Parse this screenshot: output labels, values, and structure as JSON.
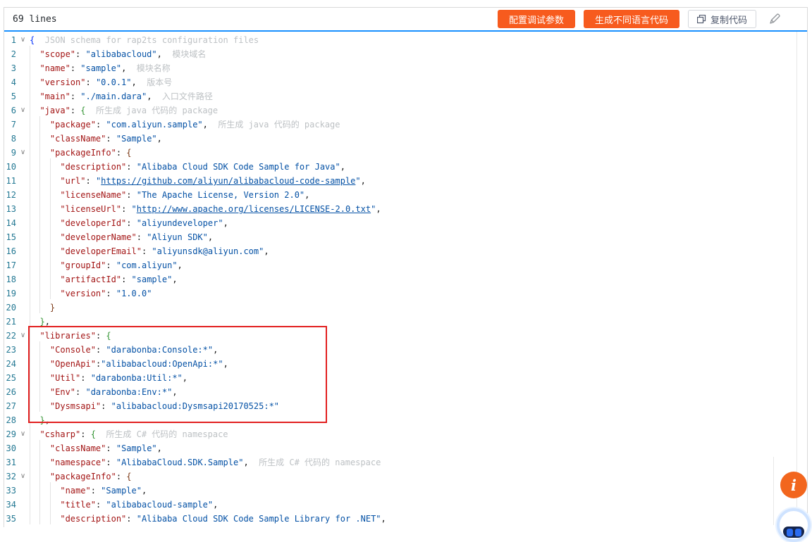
{
  "header": {
    "title": "69 lines",
    "buttons": [
      {
        "label": "配置调试参数"
      },
      {
        "label": "生成不同语言代码"
      }
    ],
    "copy_button": {
      "label": "复制代码",
      "icon": "copy-icon"
    },
    "edit_icon": "pencil-icon"
  },
  "colors": {
    "accent_orange": "#f75b1e",
    "header_rule_blue": "#1890ff",
    "highlight_box_red": "#e21f1f",
    "line_number_teal": "#237893",
    "json_key_red": "#a31515",
    "json_value_blue": "#0451a5",
    "hint_gray": "#bdc1c4"
  },
  "annotations": {
    "highlight_box_lines": [
      22,
      28
    ]
  },
  "widgets": {
    "info_label": "i",
    "robot_icon": "robot-assistant-icon"
  },
  "editor": {
    "fold_glyph": "∨",
    "lines": [
      {
        "n": 1,
        "fold": true,
        "tokens": [
          [
            "b1",
            "{"
          ],
          [
            "c",
            "  JSON schema for rap2ts configuration files"
          ]
        ]
      },
      {
        "n": 2,
        "fold": false,
        "tokens": [
          [
            "p",
            "  "
          ],
          [
            "k",
            "\"scope\""
          ],
          [
            "p",
            ": "
          ],
          [
            "s",
            "\"alibabacloud\""
          ],
          [
            "p",
            ","
          ],
          [
            "c",
            "  模块域名"
          ]
        ]
      },
      {
        "n": 3,
        "fold": false,
        "tokens": [
          [
            "p",
            "  "
          ],
          [
            "k",
            "\"name\""
          ],
          [
            "p",
            ": "
          ],
          [
            "s",
            "\"sample\""
          ],
          [
            "p",
            ","
          ],
          [
            "c",
            "  模块名称"
          ]
        ]
      },
      {
        "n": 4,
        "fold": false,
        "tokens": [
          [
            "p",
            "  "
          ],
          [
            "k",
            "\"version\""
          ],
          [
            "p",
            ": "
          ],
          [
            "s",
            "\"0.0.1\""
          ],
          [
            "p",
            ","
          ],
          [
            "c",
            "  版本号"
          ]
        ]
      },
      {
        "n": 5,
        "fold": false,
        "tokens": [
          [
            "p",
            "  "
          ],
          [
            "k",
            "\"main\""
          ],
          [
            "p",
            ": "
          ],
          [
            "s",
            "\"./main.dara\""
          ],
          [
            "p",
            ","
          ],
          [
            "c",
            "  入口文件路径"
          ]
        ]
      },
      {
        "n": 6,
        "fold": true,
        "tokens": [
          [
            "p",
            "  "
          ],
          [
            "k",
            "\"java\""
          ],
          [
            "p",
            ": "
          ],
          [
            "b2",
            "{"
          ],
          [
            "c",
            "  所生成 java 代码的 package"
          ]
        ]
      },
      {
        "n": 7,
        "fold": false,
        "tokens": [
          [
            "p",
            "    "
          ],
          [
            "k",
            "\"package\""
          ],
          [
            "p",
            ": "
          ],
          [
            "s",
            "\"com.aliyun.sample\""
          ],
          [
            "p",
            ","
          ],
          [
            "c",
            "  所生成 java 代码的 package"
          ]
        ]
      },
      {
        "n": 8,
        "fold": false,
        "tokens": [
          [
            "p",
            "    "
          ],
          [
            "k",
            "\"className\""
          ],
          [
            "p",
            ": "
          ],
          [
            "s",
            "\"Sample\""
          ],
          [
            "p",
            ","
          ]
        ]
      },
      {
        "n": 9,
        "fold": true,
        "tokens": [
          [
            "p",
            "    "
          ],
          [
            "k",
            "\"packageInfo\""
          ],
          [
            "p",
            ": "
          ],
          [
            "b3",
            "{"
          ]
        ]
      },
      {
        "n": 10,
        "fold": false,
        "tokens": [
          [
            "p",
            "      "
          ],
          [
            "k",
            "\"description\""
          ],
          [
            "p",
            ": "
          ],
          [
            "s",
            "\"Alibaba Cloud SDK Code Sample for Java\""
          ],
          [
            "p",
            ","
          ]
        ]
      },
      {
        "n": 11,
        "fold": false,
        "tokens": [
          [
            "p",
            "      "
          ],
          [
            "k",
            "\"url\""
          ],
          [
            "p",
            ": "
          ],
          [
            "s",
            "\""
          ],
          [
            "u",
            "https://github.com/aliyun/alibabacloud-code-sample"
          ],
          [
            "s",
            "\""
          ],
          [
            "p",
            ","
          ]
        ]
      },
      {
        "n": 12,
        "fold": false,
        "tokens": [
          [
            "p",
            "      "
          ],
          [
            "k",
            "\"licenseName\""
          ],
          [
            "p",
            ": "
          ],
          [
            "s",
            "\"The Apache License, Version 2.0\""
          ],
          [
            "p",
            ","
          ]
        ]
      },
      {
        "n": 13,
        "fold": false,
        "tokens": [
          [
            "p",
            "      "
          ],
          [
            "k",
            "\"licenseUrl\""
          ],
          [
            "p",
            ": "
          ],
          [
            "s",
            "\""
          ],
          [
            "u",
            "http://www.apache.org/licenses/LICENSE-2.0.txt"
          ],
          [
            "s",
            "\""
          ],
          [
            "p",
            ","
          ]
        ]
      },
      {
        "n": 14,
        "fold": false,
        "tokens": [
          [
            "p",
            "      "
          ],
          [
            "k",
            "\"developerId\""
          ],
          [
            "p",
            ": "
          ],
          [
            "s",
            "\"aliyundeveloper\""
          ],
          [
            "p",
            ","
          ]
        ]
      },
      {
        "n": 15,
        "fold": false,
        "tokens": [
          [
            "p",
            "      "
          ],
          [
            "k",
            "\"developerName\""
          ],
          [
            "p",
            ": "
          ],
          [
            "s",
            "\"Aliyun SDK\""
          ],
          [
            "p",
            ","
          ]
        ]
      },
      {
        "n": 16,
        "fold": false,
        "tokens": [
          [
            "p",
            "      "
          ],
          [
            "k",
            "\"developerEmail\""
          ],
          [
            "p",
            ": "
          ],
          [
            "s",
            "\"aliyunsdk@aliyun.com\""
          ],
          [
            "p",
            ","
          ]
        ]
      },
      {
        "n": 17,
        "fold": false,
        "tokens": [
          [
            "p",
            "      "
          ],
          [
            "k",
            "\"groupId\""
          ],
          [
            "p",
            ": "
          ],
          [
            "s",
            "\"com.aliyun\""
          ],
          [
            "p",
            ","
          ]
        ]
      },
      {
        "n": 18,
        "fold": false,
        "tokens": [
          [
            "p",
            "      "
          ],
          [
            "k",
            "\"artifactId\""
          ],
          [
            "p",
            ": "
          ],
          [
            "s",
            "\"sample\""
          ],
          [
            "p",
            ","
          ]
        ]
      },
      {
        "n": 19,
        "fold": false,
        "tokens": [
          [
            "p",
            "      "
          ],
          [
            "k",
            "\"version\""
          ],
          [
            "p",
            ": "
          ],
          [
            "s",
            "\"1.0.0\""
          ]
        ]
      },
      {
        "n": 20,
        "fold": false,
        "tokens": [
          [
            "p",
            "    "
          ],
          [
            "b3",
            "}"
          ]
        ]
      },
      {
        "n": 21,
        "fold": false,
        "tokens": [
          [
            "p",
            "  "
          ],
          [
            "b2",
            "}"
          ],
          [
            "p",
            ","
          ]
        ]
      },
      {
        "n": 22,
        "fold": true,
        "tokens": [
          [
            "p",
            "  "
          ],
          [
            "k",
            "\"libraries\""
          ],
          [
            "p",
            ": "
          ],
          [
            "b2",
            "{"
          ]
        ]
      },
      {
        "n": 23,
        "fold": false,
        "tokens": [
          [
            "p",
            "    "
          ],
          [
            "k",
            "\"Console\""
          ],
          [
            "p",
            ": "
          ],
          [
            "s",
            "\"darabonba:Console:*\""
          ],
          [
            "p",
            ","
          ]
        ]
      },
      {
        "n": 24,
        "fold": false,
        "tokens": [
          [
            "p",
            "    "
          ],
          [
            "k",
            "\"OpenApi\""
          ],
          [
            "p",
            ":"
          ],
          [
            "s",
            "\"alibabacloud:OpenApi:*\""
          ],
          [
            "p",
            ","
          ]
        ]
      },
      {
        "n": 25,
        "fold": false,
        "tokens": [
          [
            "p",
            "    "
          ],
          [
            "k",
            "\"Util\""
          ],
          [
            "p",
            ": "
          ],
          [
            "s",
            "\"darabonba:Util:*\""
          ],
          [
            "p",
            ","
          ]
        ]
      },
      {
        "n": 26,
        "fold": false,
        "tokens": [
          [
            "p",
            "    "
          ],
          [
            "k",
            "\"Env\""
          ],
          [
            "p",
            ": "
          ],
          [
            "s",
            "\"darabonba:Env:*\""
          ],
          [
            "p",
            ","
          ]
        ]
      },
      {
        "n": 27,
        "fold": false,
        "tokens": [
          [
            "p",
            "    "
          ],
          [
            "k",
            "\"Dysmsapi\""
          ],
          [
            "p",
            ": "
          ],
          [
            "s",
            "\"alibabacloud:Dysmsapi20170525:*\""
          ]
        ]
      },
      {
        "n": 28,
        "fold": false,
        "tokens": [
          [
            "p",
            "  "
          ],
          [
            "b2",
            "}"
          ],
          [
            "p",
            ","
          ]
        ]
      },
      {
        "n": 29,
        "fold": true,
        "tokens": [
          [
            "p",
            "  "
          ],
          [
            "k",
            "\"csharp\""
          ],
          [
            "p",
            ": "
          ],
          [
            "b2",
            "{"
          ],
          [
            "c",
            "  所生成 C# 代码的 namespace"
          ]
        ]
      },
      {
        "n": 30,
        "fold": false,
        "tokens": [
          [
            "p",
            "    "
          ],
          [
            "k",
            "\"className\""
          ],
          [
            "p",
            ": "
          ],
          [
            "s",
            "\"Sample\""
          ],
          [
            "p",
            ","
          ]
        ]
      },
      {
        "n": 31,
        "fold": false,
        "tokens": [
          [
            "p",
            "    "
          ],
          [
            "k",
            "\"namespace\""
          ],
          [
            "p",
            ": "
          ],
          [
            "s",
            "\"AlibabaCloud.SDK.Sample\""
          ],
          [
            "p",
            ","
          ],
          [
            "c",
            "  所生成 C# 代码的 namespace"
          ]
        ]
      },
      {
        "n": 32,
        "fold": true,
        "tokens": [
          [
            "p",
            "    "
          ],
          [
            "k",
            "\"packageInfo\""
          ],
          [
            "p",
            ": "
          ],
          [
            "b3",
            "{"
          ]
        ]
      },
      {
        "n": 33,
        "fold": false,
        "tokens": [
          [
            "p",
            "      "
          ],
          [
            "k",
            "\"name\""
          ],
          [
            "p",
            ": "
          ],
          [
            "s",
            "\"Sample\""
          ],
          [
            "p",
            ","
          ]
        ]
      },
      {
        "n": 34,
        "fold": false,
        "tokens": [
          [
            "p",
            "      "
          ],
          [
            "k",
            "\"title\""
          ],
          [
            "p",
            ": "
          ],
          [
            "s",
            "\"alibabacloud-sample\""
          ],
          [
            "p",
            ","
          ]
        ]
      },
      {
        "n": 35,
        "fold": false,
        "tokens": [
          [
            "p",
            "      "
          ],
          [
            "k",
            "\"description\""
          ],
          [
            "p",
            ": "
          ],
          [
            "s",
            "\"Alibaba Cloud SDK Code Sample Library for .NET\""
          ],
          [
            "p",
            ","
          ]
        ]
      }
    ]
  }
}
